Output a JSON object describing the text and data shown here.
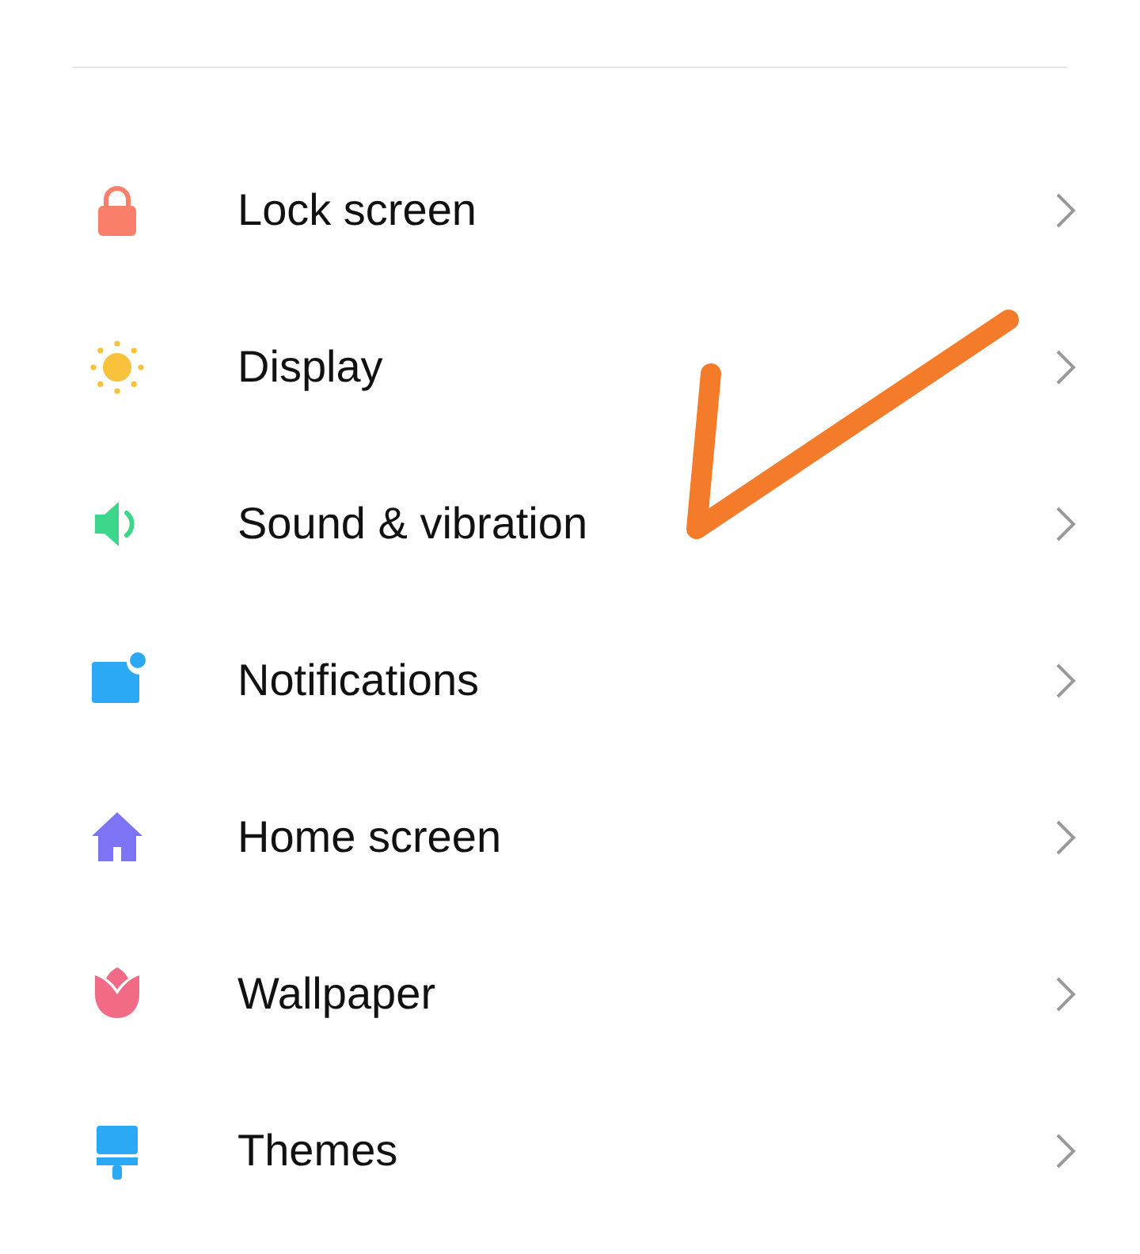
{
  "items": [
    {
      "label": "Lock screen",
      "kind": "lock",
      "color": "#f97f6a"
    },
    {
      "label": "Display",
      "kind": "sun",
      "color": "#f9c23c"
    },
    {
      "label": "Sound & vibration",
      "kind": "speaker",
      "color": "#3ed68b"
    },
    {
      "label": "Notifications",
      "kind": "notification",
      "color": "#2ba9f5"
    },
    {
      "label": "Home screen",
      "kind": "home",
      "color": "#7d74f5"
    },
    {
      "label": "Wallpaper",
      "kind": "tulip",
      "color": "#f26b86"
    },
    {
      "label": "Themes",
      "kind": "brush",
      "color": "#2ba9f5"
    }
  ]
}
